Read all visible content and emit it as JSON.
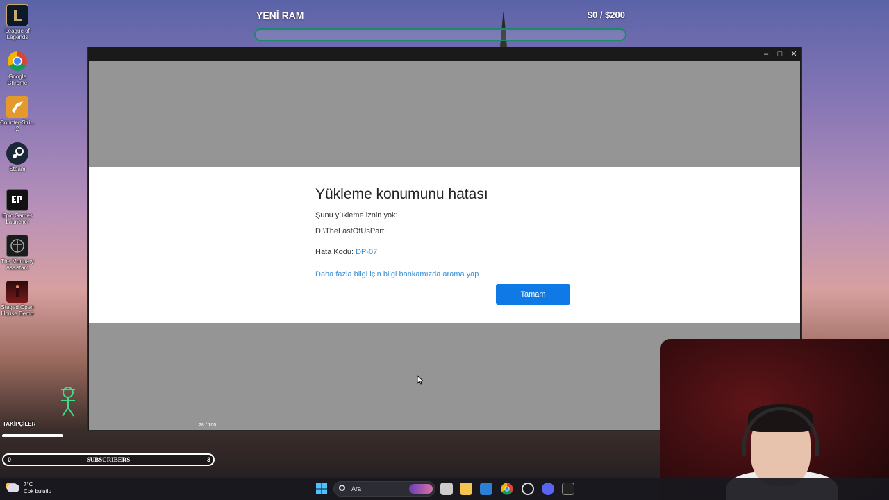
{
  "desktop_icons": [
    {
      "label": "League of Legends",
      "icon": "league-of-legends-icon"
    },
    {
      "label": "Google Chrome",
      "icon": "chrome-icon"
    },
    {
      "label": "Counter-Stri... 2",
      "icon": "counter-strike-icon"
    },
    {
      "label": "Steam",
      "icon": "steam-icon"
    },
    {
      "label": "Epic Games Launcher",
      "icon": "epic-games-icon"
    },
    {
      "label": "The Mortuary Assistant",
      "icon": "mortuary-assistant-icon"
    },
    {
      "label": "Staged Open House Demo",
      "icon": "staged-open-house-icon"
    }
  ],
  "goal": {
    "title": "YENİ RAM",
    "amount": "$0 / $200",
    "progress": 0.0
  },
  "window": {
    "controls": {
      "minimize": "–",
      "maximize": "□",
      "close": "✕"
    },
    "dialog": {
      "title": "Yükleme konumunu hatası",
      "message": "Şunu yükleme iznin yok:",
      "path": "D:\\TheLastOfUsPartI",
      "error_label": "Hata Kodu:",
      "error_code": "DP-07",
      "help_link": "Daha fazla bilgi için bilgi bankamızda arama yap",
      "ok_button": "Tamam"
    },
    "progress_text": "28 / 100"
  },
  "followers": {
    "label": "TAKİPÇİLER",
    "subs_label": "SUBSCRIBERS",
    "subs_current": "0",
    "subs_goal": "3"
  },
  "taskbar": {
    "weather_temp": "7°C",
    "weather_desc": "Çok bulutlu",
    "search_placeholder": "Ara"
  },
  "colors": {
    "accent": "#0f7ae5",
    "link": "#3a8fd6",
    "goal_bar": "#1a8a6a"
  }
}
